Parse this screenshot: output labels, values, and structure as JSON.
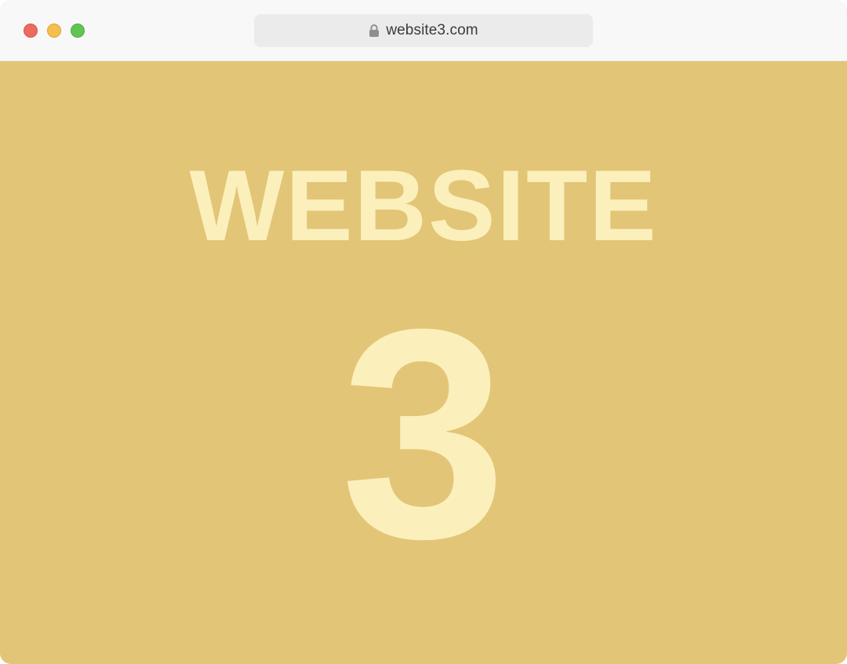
{
  "browser": {
    "url": "website3.com",
    "lock_icon": "lock-icon",
    "window_controls": [
      "close",
      "minimize",
      "maximize"
    ]
  },
  "page": {
    "headline": "WEBSITE",
    "number": "3"
  },
  "colors": {
    "background": "#e3c578",
    "text": "#fbf0bb",
    "titlebar": "#f8f8f8",
    "addressbar": "#ebebeb",
    "close": "#ed6a5e",
    "minimize": "#f4bf4f",
    "maximize": "#61c554"
  }
}
